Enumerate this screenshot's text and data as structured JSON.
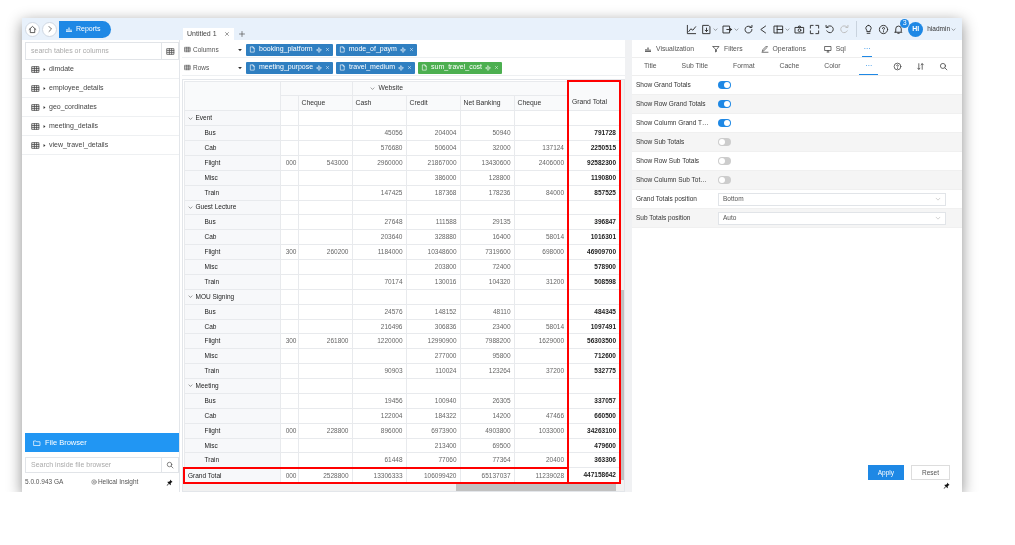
{
  "breadcrumb": {
    "current": "Reports"
  },
  "tabs": [
    {
      "label": "Untitled 1",
      "selected": true
    }
  ],
  "toolbar": [
    {
      "kind": "line-chart"
    },
    {
      "kind": "export",
      "menu": true
    },
    {
      "kind": "save-as",
      "menu": true
    },
    {
      "kind": "refresh"
    },
    {
      "kind": "share"
    },
    {
      "kind": "layout",
      "menu": true
    },
    {
      "kind": "camera"
    },
    {
      "kind": "fullscreen"
    },
    {
      "kind": "undo"
    },
    {
      "kind": "redo",
      "disabled": true
    },
    {
      "kind": "bulb"
    },
    {
      "kind": "help"
    },
    {
      "kind": "bell",
      "badge": "3"
    }
  ],
  "user": {
    "initials": "HI",
    "name": "hiadmin"
  },
  "sidebar": {
    "search_placeholder": "search tables or columns",
    "tables": [
      "dimdate",
      "employee_details",
      "geo_cordinates",
      "meeting_details",
      "view_travel_details"
    ],
    "file_browser": "File Browser",
    "file_search_placeholder": "Search inside file browser",
    "version": "5.0.0.943 GA",
    "brand": "Helical Insight"
  },
  "shelves": [
    {
      "label": "Columns",
      "pills": [
        {
          "text": "booking_platform",
          "kind": "dimension"
        },
        {
          "text": "mode_of_paym",
          "kind": "dimension"
        }
      ]
    },
    {
      "label": "Rows",
      "pills": [
        {
          "text": "meeting_purpose",
          "kind": "dimension"
        },
        {
          "text": "travel_medium",
          "kind": "dimension"
        },
        {
          "text": "sum_travel_cost",
          "kind": "measure"
        }
      ]
    }
  ],
  "pivot": {
    "column_groups": [
      {
        "columns": [
          {
            "kind": "cut"
          },
          {
            "label": "Cheque"
          }
        ]
      },
      {
        "label": "Website",
        "expanded": true,
        "columns": [
          {
            "label": "Cash"
          },
          {
            "label": "Credit"
          },
          {
            "label": "Net Banking"
          },
          {
            "label": "Cheque"
          }
        ]
      }
    ],
    "grand_total_column": {
      "label": "Grand Total",
      "highlighted": true
    },
    "row_groups": [
      {
        "label": "Event",
        "expanded": true,
        "children": [
          {
            "label": "Bus",
            "cells": [
              null,
              null,
              "45056",
              "204004",
              "50940",
              null
            ],
            "total": "791728"
          },
          {
            "label": "Cab",
            "cells": [
              null,
              null,
              "576680",
              "506004",
              "32000",
              "137124"
            ],
            "total": "2250515"
          },
          {
            "label": "Flight",
            "cells": [
              "000",
              "543000",
              "2960000",
              "21867000",
              "13430600",
              "2406000"
            ],
            "total": "92582300"
          },
          {
            "label": "Misc",
            "cells": [
              null,
              null,
              null,
              "386000",
              "128800",
              null
            ],
            "total": "1190800"
          },
          {
            "label": "Train",
            "cells": [
              null,
              null,
              "147425",
              "187368",
              "178236",
              "84000"
            ],
            "total": "857525"
          }
        ]
      },
      {
        "label": "Guest Lecture",
        "expanded": true,
        "children": [
          {
            "label": "Bus",
            "cells": [
              null,
              null,
              "27648",
              "111588",
              "29135",
              null
            ],
            "total": "396847"
          },
          {
            "label": "Cab",
            "cells": [
              null,
              null,
              "203640",
              "328880",
              "16400",
              "58014"
            ],
            "total": "1016301"
          },
          {
            "label": "Flight",
            "cells": [
              "300",
              "260200",
              "1184000",
              "10348600",
              "7319600",
              "698000"
            ],
            "total": "46909700"
          },
          {
            "label": "Misc",
            "cells": [
              null,
              null,
              null,
              "203800",
              "72400",
              null
            ],
            "total": "578900"
          },
          {
            "label": "Train",
            "cells": [
              null,
              null,
              "70174",
              "130016",
              "104320",
              "31200"
            ],
            "total": "508598"
          }
        ]
      },
      {
        "label": "MOU Signing",
        "expanded": true,
        "children": [
          {
            "label": "Bus",
            "cells": [
              null,
              null,
              "24576",
              "148152",
              "48110",
              null
            ],
            "total": "484345"
          },
          {
            "label": "Cab",
            "cells": [
              null,
              null,
              "216496",
              "306836",
              "23400",
              "58014"
            ],
            "total": "1097491"
          },
          {
            "label": "Flight",
            "cells": [
              "300",
              "261800",
              "1220000",
              "12990900",
              "7988200",
              "1629000"
            ],
            "total": "56303500"
          },
          {
            "label": "Misc",
            "cells": [
              null,
              null,
              null,
              "277000",
              "95800",
              null
            ],
            "total": "712600"
          },
          {
            "label": "Train",
            "cells": [
              null,
              null,
              "90903",
              "110024",
              "123264",
              "37200"
            ],
            "total": "532775"
          }
        ]
      },
      {
        "label": "Meeting",
        "expanded": true,
        "children": [
          {
            "label": "Bus",
            "cells": [
              null,
              null,
              "19456",
              "100940",
              "26305",
              null
            ],
            "total": "337057"
          },
          {
            "label": "Cab",
            "cells": [
              null,
              null,
              "122004",
              "184322",
              "14200",
              "47466"
            ],
            "total": "660500"
          },
          {
            "label": "Flight",
            "cells": [
              "000",
              "228800",
              "896000",
              "6973900",
              "4903800",
              "1033000"
            ],
            "total": "34263100"
          },
          {
            "label": "Misc",
            "cells": [
              null,
              null,
              null,
              "213400",
              "69500",
              null
            ],
            "total": "479600"
          },
          {
            "label": "Train",
            "cells": [
              null,
              null,
              "61448",
              "77060",
              "77364",
              "20400"
            ],
            "total": "363306"
          }
        ]
      }
    ],
    "grand_total_row": {
      "label": "Grand Total",
      "highlighted": true,
      "cells": [
        "000",
        "2528800",
        "13306333",
        "106099420",
        "65137037",
        "11239028"
      ],
      "total": "447158642"
    }
  },
  "panel_tabs": [
    {
      "kind": "visualization",
      "label": "Visualization",
      "selected": false
    },
    {
      "kind": "filters",
      "label": "Filters",
      "selected": false
    },
    {
      "kind": "operations",
      "label": "Operations",
      "selected": false
    },
    {
      "kind": "sql",
      "label": "Sql",
      "selected": false
    },
    {
      "kind": "more",
      "label": "···",
      "selected": true
    }
  ],
  "sub_tabs": [
    {
      "label": "Title",
      "selected": false
    },
    {
      "label": "Sub Title",
      "selected": false
    },
    {
      "label": "Format",
      "selected": false
    },
    {
      "label": "Cache",
      "selected": false
    },
    {
      "label": "Color",
      "selected": false
    },
    {
      "label": "···",
      "selected": true
    }
  ],
  "settings": [
    {
      "kind": "toggle",
      "label": "Show Grand Totals",
      "on": true
    },
    {
      "kind": "toggle",
      "label": "Show Row Grand Totals",
      "on": true
    },
    {
      "kind": "toggle",
      "label": "Show Column Grand T…",
      "on": true
    },
    {
      "kind": "toggle",
      "label": "Show Sub Totals",
      "on": false
    },
    {
      "kind": "toggle",
      "label": "Show Row Sub Totals",
      "on": false
    },
    {
      "kind": "toggle",
      "label": "Show Column Sub Tot…",
      "on": false
    },
    {
      "kind": "select",
      "label": "Grand Totals position",
      "value": "Bottom"
    },
    {
      "kind": "select",
      "label": "Sub Totals position",
      "value": "Auto"
    }
  ],
  "actions": [
    {
      "kind": "primary",
      "label": "Apply"
    },
    {
      "kind": "secondary",
      "label": "Reset"
    }
  ]
}
